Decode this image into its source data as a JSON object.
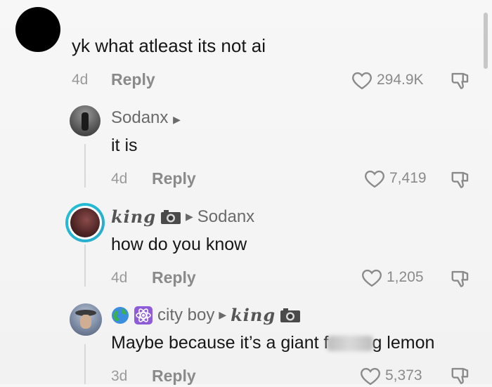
{
  "comment_main": {
    "text": "yk what atleast its not ai",
    "time": "4d",
    "reply_label": "Reply",
    "likes": "294.9K"
  },
  "reply1": {
    "author": "Sodanx",
    "text": "it is",
    "time": "4d",
    "reply_label": "Reply",
    "likes": "7,419"
  },
  "reply2": {
    "author": "king",
    "reply_to": "Sodanx",
    "text": "how do you know",
    "time": "4d",
    "reply_label": "Reply",
    "likes": "1,205"
  },
  "reply3": {
    "author": "city boy",
    "reply_to": "king",
    "text_before": "Maybe because it’s a giant f",
    "text_after": "g lemon",
    "time": "3d",
    "reply_label": "Reply",
    "likes": "5,373"
  },
  "icons": {
    "like": "heart-outline-icon",
    "dislike": "thumbs-down-outline-icon",
    "camera": "camera-emoji-icon",
    "globe": "globe-emoji-icon",
    "atom": "atom-emoji-icon",
    "reply_arrow": "play-triangle-icon"
  }
}
